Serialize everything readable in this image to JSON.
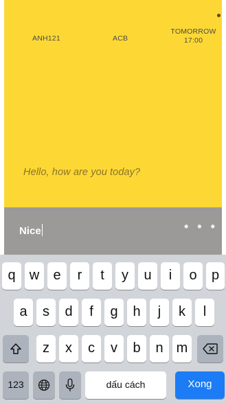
{
  "chat": {
    "flight_code": "ANH121",
    "bank": "ACB",
    "time_day": "TOMORROW",
    "time_hour": "17:00",
    "message": "Hello, how are you today?"
  },
  "input": {
    "value": "Nice",
    "more": "• • •"
  },
  "keyboard": {
    "row1": [
      "q",
      "w",
      "e",
      "r",
      "t",
      "y",
      "u",
      "i",
      "o",
      "p"
    ],
    "row2": [
      "a",
      "s",
      "d",
      "f",
      "g",
      "h",
      "j",
      "k",
      "l"
    ],
    "row3": [
      "z",
      "x",
      "c",
      "v",
      "b",
      "n",
      "m"
    ],
    "numbers_label": "123",
    "space_label": "dấu cách",
    "return_label": "Xong",
    "shift_icon": "shift-icon",
    "delete_icon": "delete-icon",
    "globe_icon": "globe-icon",
    "mic_icon": "microphone-icon"
  },
  "colors": {
    "accent_yellow": "#fdd835",
    "input_bar": "#9c9a98",
    "keyboard_bg": "#d1d4d9",
    "return_blue": "#1b7cf6"
  }
}
